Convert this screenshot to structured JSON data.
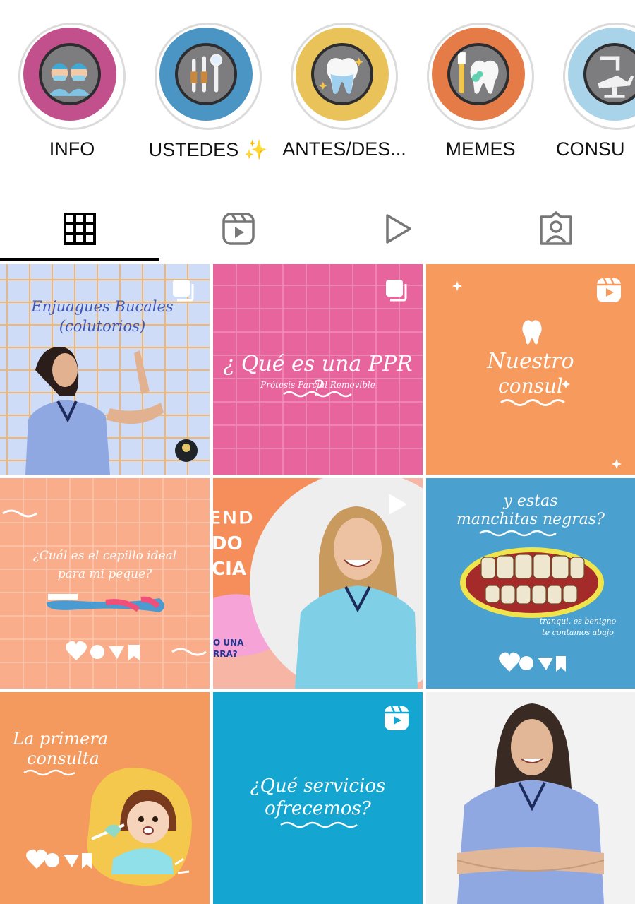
{
  "highlights": [
    {
      "label": "INFO",
      "color": "#c2508c",
      "icon": "doctors-icon"
    },
    {
      "label": "USTEDES ✨",
      "color": "#4b95c4",
      "icon": "dental-tools-icon"
    },
    {
      "label": "ANTES/DES...",
      "color": "#e9c35a",
      "icon": "tooth-sparkle-icon"
    },
    {
      "label": "MEMES",
      "color": "#e57c47",
      "icon": "tooth-brush-icon"
    },
    {
      "label": "CONSU",
      "color": "#a9d3e8",
      "icon": "dental-chair-icon"
    }
  ],
  "tabs": [
    {
      "name": "grid-icon",
      "active": true
    },
    {
      "name": "reels-icon",
      "active": false
    },
    {
      "name": "play-icon",
      "active": false
    },
    {
      "name": "tagged-icon",
      "active": false
    }
  ],
  "posts": [
    {
      "title_line1": "Enjuagues Bucales",
      "title_line2": "(colutorios)",
      "badge": "carousel-icon",
      "bg": "#cfdcf7"
    },
    {
      "title": "¿ Qué es una PPR ?",
      "subtitle": "Prótesis Parcial Removible",
      "badge": "carousel-icon",
      "bg": "#e8649c"
    },
    {
      "title_line1": "Nuestro",
      "title_line2": "consul",
      "badge": "reels-icon",
      "bg": "#f79a5d"
    },
    {
      "title_line1": "¿Cuál es el cepillo ideal",
      "title_line2": "para mi peque?",
      "bg": "#f9ad8a"
    },
    {
      "side_text": [
        "END",
        "DO",
        "CIA"
      ],
      "bubble_text": [
        "O UNA",
        "RRA?"
      ],
      "badge": "play-icon",
      "bg": "#f58e5a"
    },
    {
      "title_line1": "y estas",
      "title_line2": "manchitas negras?",
      "note_line1": "tranqui, es benigno",
      "note_line2": "te contamos abajo",
      "bg": "#4aa1d0"
    },
    {
      "title_line1": "La primera",
      "title_line2": "consulta",
      "bg": "#f59a5e"
    },
    {
      "title_line1": "¿Qué servicios",
      "title_line2": "ofrecemos?",
      "badge": "reels-icon",
      "bg": "#14a6d1"
    },
    {
      "bg": "#f2f2f2"
    }
  ]
}
